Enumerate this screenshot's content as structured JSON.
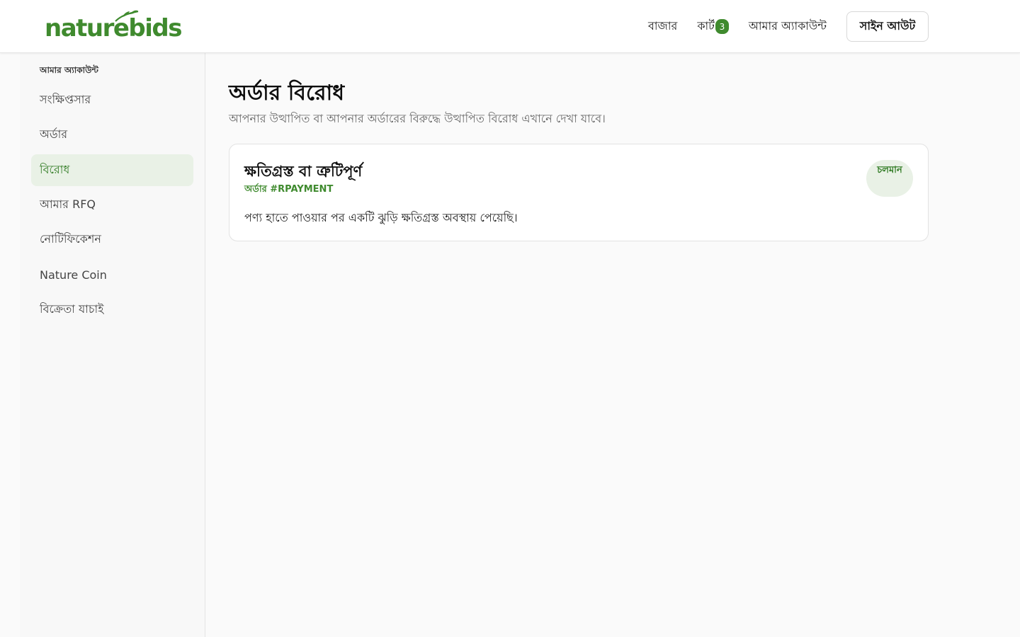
{
  "brand": {
    "name": "naturebids",
    "color": "#3f8a2e"
  },
  "nav": {
    "market": "বাজার",
    "cart": "কার্ট",
    "cart_count": "3",
    "account": "আমার অ্যাকাউন্ট",
    "signout": "সাইন আউট"
  },
  "sidebar": {
    "heading": "আমার অ্যাকাউন্ট",
    "items": [
      {
        "label": "সংক্ষিপ্তসার"
      },
      {
        "label": "অর্ডার"
      },
      {
        "label": "বিরোধ",
        "active": true
      },
      {
        "label": "আমার RFQ"
      },
      {
        "label": "নোটিফিকেশন"
      },
      {
        "label": "Nature Coin"
      },
      {
        "label": "বিক্রেতা যাচাই"
      }
    ]
  },
  "page": {
    "title": "অর্ডার বিরোধ",
    "subtitle": "আপনার উত্থাপিত বা আপনার অর্ডারের বিরুদ্ধে উত্থাপিত বিরোধ এখানে দেখা যাবে।"
  },
  "disputes": [
    {
      "title": "ক্ষতিগ্রস্ত বা ত্রুটিপূর্ণ",
      "order": "অর্ডার #RPAYMENT",
      "status": "চলমান",
      "description": "পণ্য হাতে পাওয়ার পর একটি ঝুড়ি ক্ষতিগ্রস্ত অবস্থায় পেয়েছি।"
    }
  ],
  "colors": {
    "accent": "#3f8a2e",
    "active_bg": "#e9f1e6"
  }
}
